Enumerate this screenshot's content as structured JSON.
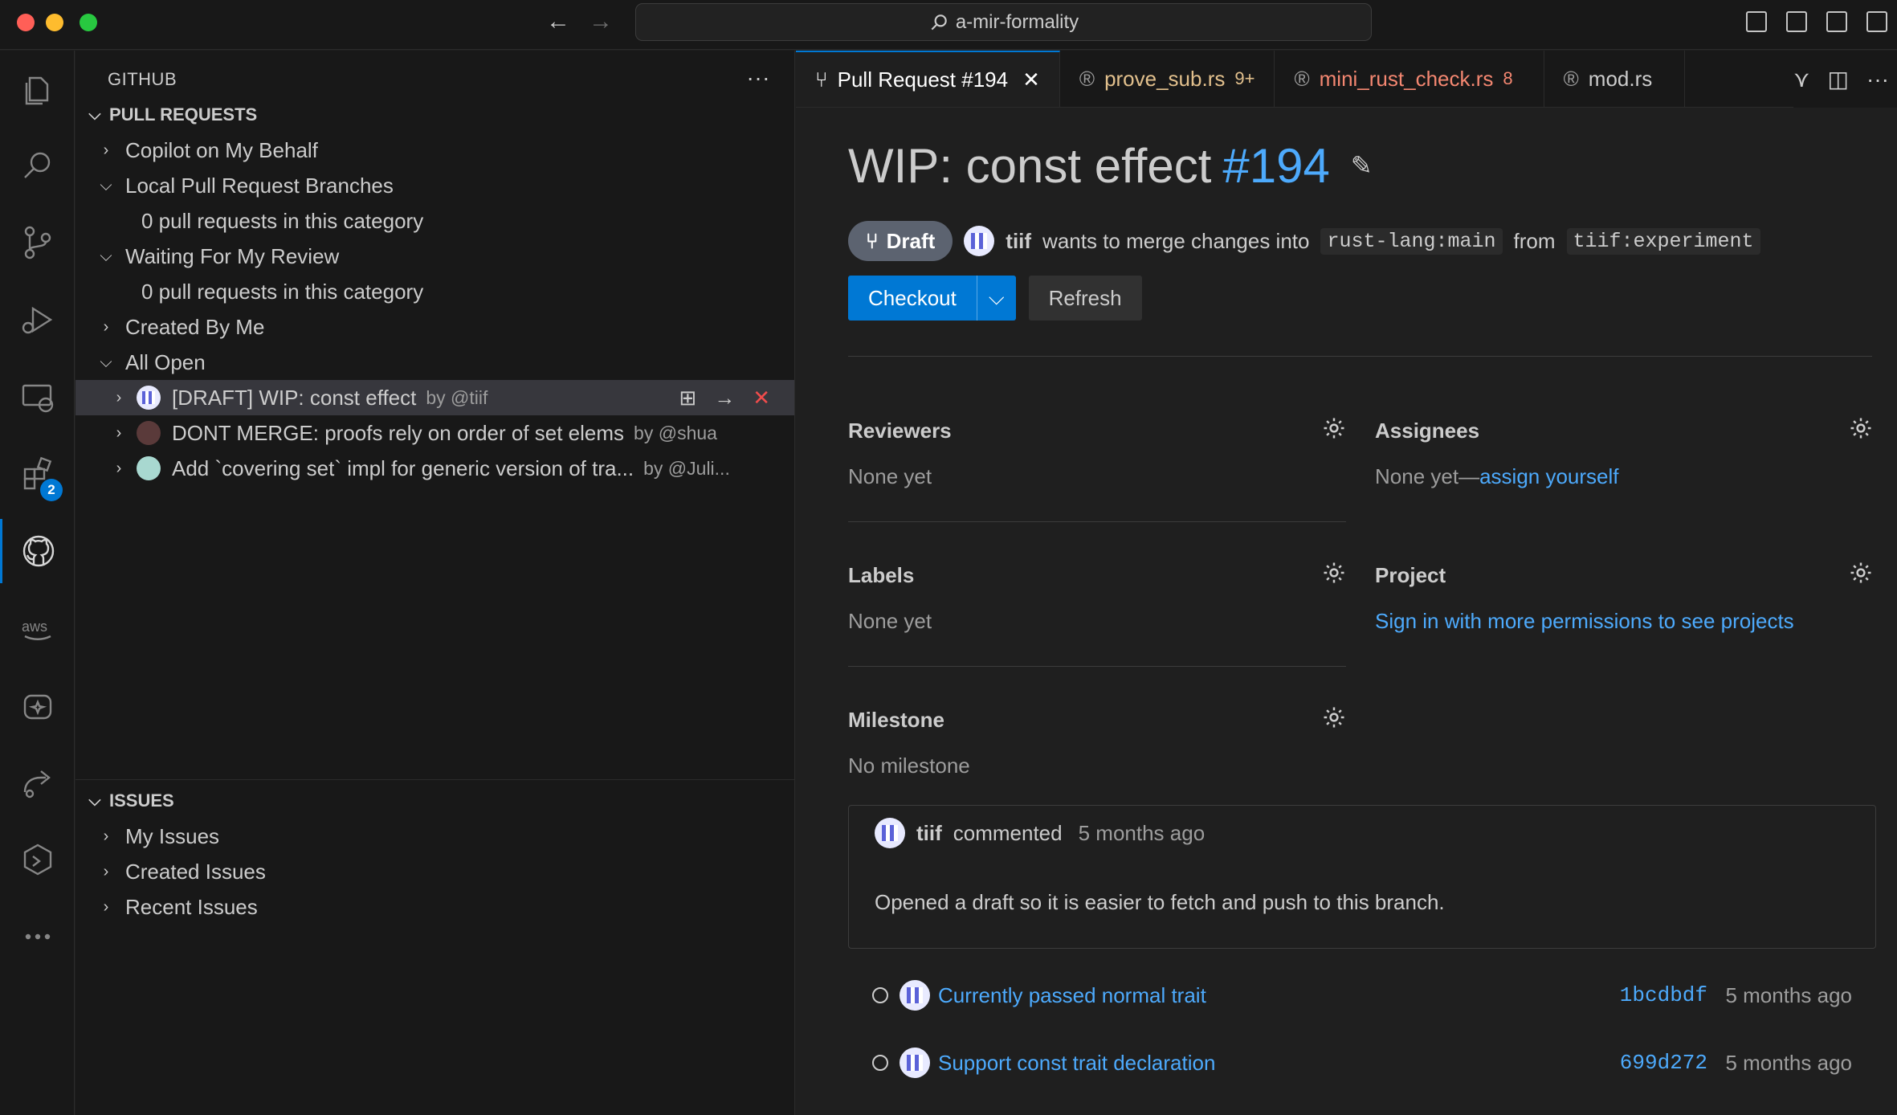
{
  "window": {
    "search_text": "a-mir-formality"
  },
  "activity_bar": {
    "extensions_badge": "2"
  },
  "sidebar": {
    "title": "GITHUB",
    "pull_requests": {
      "header": "PULL REQUESTS",
      "categories": [
        {
          "label": "Copilot on My Behalf"
        },
        {
          "label": "Local Pull Request Branches",
          "empty": "0 pull requests in this category"
        },
        {
          "label": "Waiting For My Review",
          "empty": "0 pull requests in this category"
        },
        {
          "label": "Created By Me"
        },
        {
          "label": "All Open"
        }
      ],
      "items": [
        {
          "title": "[DRAFT] WIP: const effect",
          "author": "by @tiif"
        },
        {
          "title": "DONT MERGE: proofs rely on order of set elems",
          "author": "by @shua"
        },
        {
          "title": "Add `covering set` impl for generic version of tra...",
          "author": "by @Juli..."
        }
      ]
    },
    "issues": {
      "header": "ISSUES",
      "items": [
        "My Issues",
        "Created Issues",
        "Recent Issues"
      ]
    }
  },
  "tabs": [
    {
      "label": "Pull Request #194"
    },
    {
      "label": "prove_sub.rs",
      "badge": "9+",
      "color": "#e2c08d"
    },
    {
      "label": "mini_rust_check.rs",
      "badge": "8",
      "color": "#f48771"
    },
    {
      "label": "mod.rs"
    }
  ],
  "pr": {
    "title": "WIP: const effect",
    "number": "#194",
    "status": "Draft",
    "author": "tiif",
    "merge_text": "wants to merge changes into",
    "base": "rust-lang:main",
    "from_text": "from",
    "head": "tiif:experiment",
    "checkout": "Checkout",
    "refresh": "Refresh"
  },
  "meta": {
    "reviewers": {
      "label": "Reviewers",
      "value": "None yet"
    },
    "assignees": {
      "label": "Assignees",
      "value": "None yet—",
      "link": "assign yourself"
    },
    "labels": {
      "label": "Labels",
      "value": "None yet"
    },
    "project": {
      "label": "Project",
      "link": "Sign in with more permissions to see projects"
    },
    "milestone": {
      "label": "Milestone",
      "value": "No milestone"
    }
  },
  "comment": {
    "author": "tiif",
    "action": "commented",
    "time": "5 months ago",
    "body": "Opened a draft so it is easier to fetch and push to this branch."
  },
  "commits": [
    {
      "message": "Currently passed normal trait",
      "sha": "1bcdbdf",
      "time": "5 months ago"
    },
    {
      "message": "Support const trait declaration",
      "sha": "699d272",
      "time": "5 months ago"
    }
  ]
}
